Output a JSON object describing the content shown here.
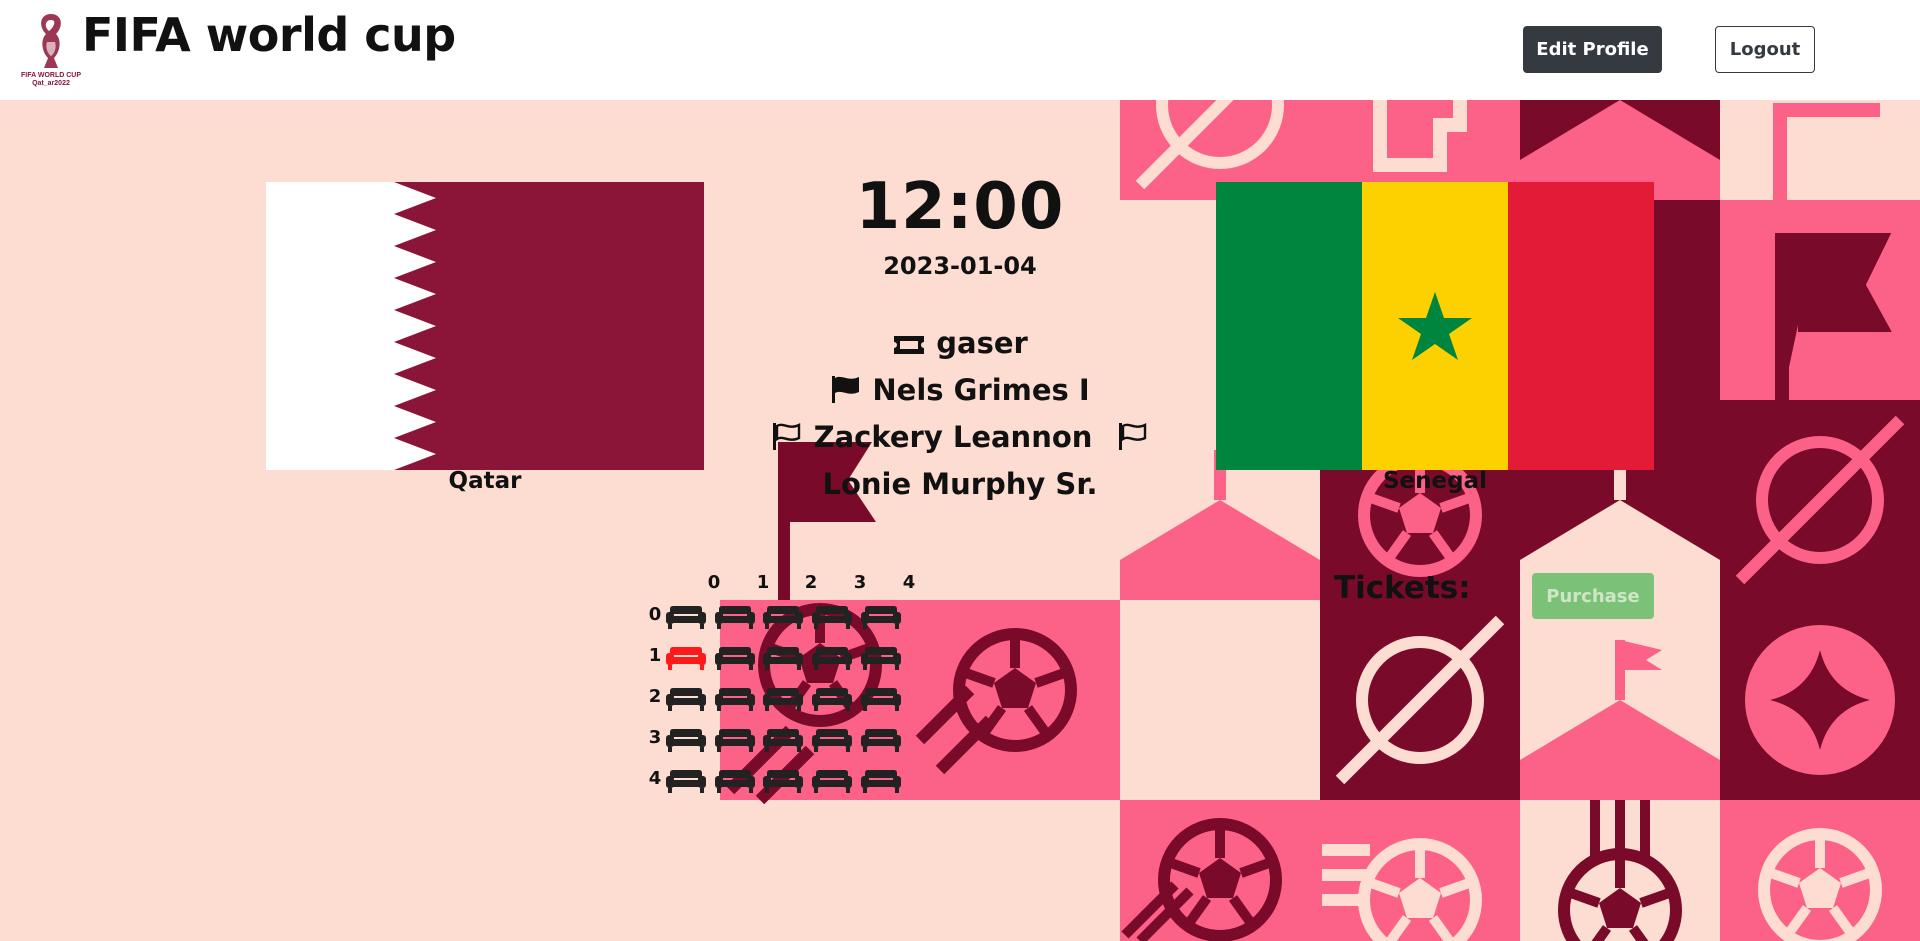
{
  "header": {
    "brand_title": "FIFA world cup",
    "logo_text": "FIFA WORLD CUP Qat_ar2022",
    "edit_profile_label": "Edit Profile",
    "logout_label": "Logout"
  },
  "match": {
    "home_team": "Qatar",
    "away_team": "Senegal",
    "time": "12:00",
    "date": "2023-01-04",
    "stadium": "gaser",
    "main_referee": "Nels Grimes I",
    "linesman_1": "Zackery Leannon",
    "linesman_2": "Lonie Murphy Sr."
  },
  "seats": {
    "column_labels": [
      "0",
      "1",
      "2",
      "3",
      "4"
    ],
    "row_labels": [
      "0",
      "1",
      "2",
      "3",
      "4"
    ],
    "reserved": [
      [
        1,
        0
      ]
    ],
    "colors": {
      "available": "#222222",
      "reserved": "#ff1a1a"
    }
  },
  "tickets": {
    "label": "Tickets:",
    "purchase_label": "Purchase"
  },
  "colors": {
    "maroon": "#8a1538",
    "dark_maroon": "#7a0a2a",
    "pink": "#fc6288",
    "background": "#fddcd1",
    "senegal_green": "#00853f",
    "senegal_yellow": "#fdd000",
    "senegal_red": "#e31b36"
  }
}
